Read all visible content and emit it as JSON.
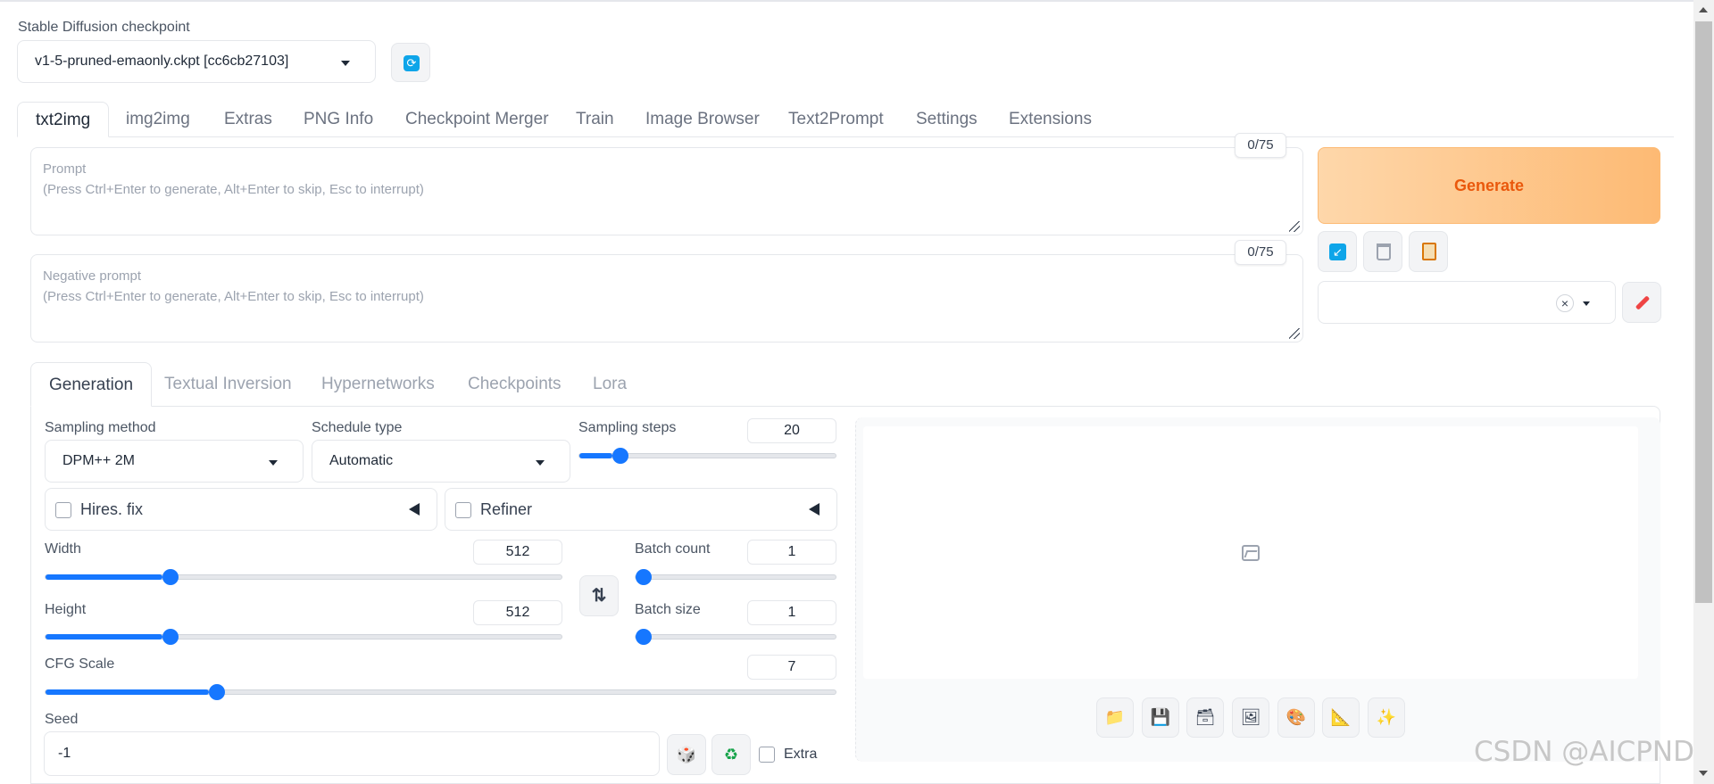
{
  "checkpoint": {
    "label": "Stable Diffusion checkpoint",
    "value": "v1-5-pruned-emaonly.ckpt [cc6cb27103]"
  },
  "main_tabs": [
    {
      "label": "txt2img",
      "active": true
    },
    {
      "label": "img2img"
    },
    {
      "label": "Extras"
    },
    {
      "label": "PNG Info"
    },
    {
      "label": "Checkpoint Merger"
    },
    {
      "label": "Train"
    },
    {
      "label": "Image Browser"
    },
    {
      "label": "Text2Prompt"
    },
    {
      "label": "Settings"
    },
    {
      "label": "Extensions"
    }
  ],
  "prompt": {
    "title": "Prompt",
    "placeholder": "(Press Ctrl+Enter to generate, Alt+Enter to skip, Esc to interrupt)",
    "token_count": "0/75"
  },
  "negative_prompt": {
    "title": "Negative prompt",
    "placeholder": "(Press Ctrl+Enter to generate, Alt+Enter to skip, Esc to interrupt)",
    "token_count": "0/75"
  },
  "generate": {
    "label": "Generate"
  },
  "style": {
    "clear": "×"
  },
  "sub_tabs": [
    {
      "label": "Generation",
      "active": true
    },
    {
      "label": "Textual Inversion"
    },
    {
      "label": "Hypernetworks"
    },
    {
      "label": "Checkpoints"
    },
    {
      "label": "Lora"
    }
  ],
  "sampling_method": {
    "label": "Sampling method",
    "value": "DPM++ 2M"
  },
  "schedule_type": {
    "label": "Schedule type",
    "value": "Automatic"
  },
  "sampling_steps": {
    "label": "Sampling steps",
    "value": "20",
    "min": 1,
    "max": 150
  },
  "hires_fix": {
    "label": "Hires. fix",
    "checked": false
  },
  "refiner": {
    "label": "Refiner",
    "checked": false
  },
  "width": {
    "label": "Width",
    "value": "512",
    "min": 64,
    "max": 2048
  },
  "height": {
    "label": "Height",
    "value": "512",
    "min": 64,
    "max": 2048
  },
  "batch_count": {
    "label": "Batch count",
    "value": "1",
    "min": 1,
    "max": 100
  },
  "batch_size": {
    "label": "Batch size",
    "value": "1",
    "min": 1,
    "max": 8
  },
  "cfg_scale": {
    "label": "CFG Scale",
    "value": "7",
    "min": 1,
    "max": 30
  },
  "seed": {
    "label": "Seed",
    "value": "-1",
    "extra_label": "Extra"
  },
  "watermark": "CSDN @AICPND",
  "colors": {
    "accent": "#1677ff",
    "generate_text": "#ea580c"
  }
}
